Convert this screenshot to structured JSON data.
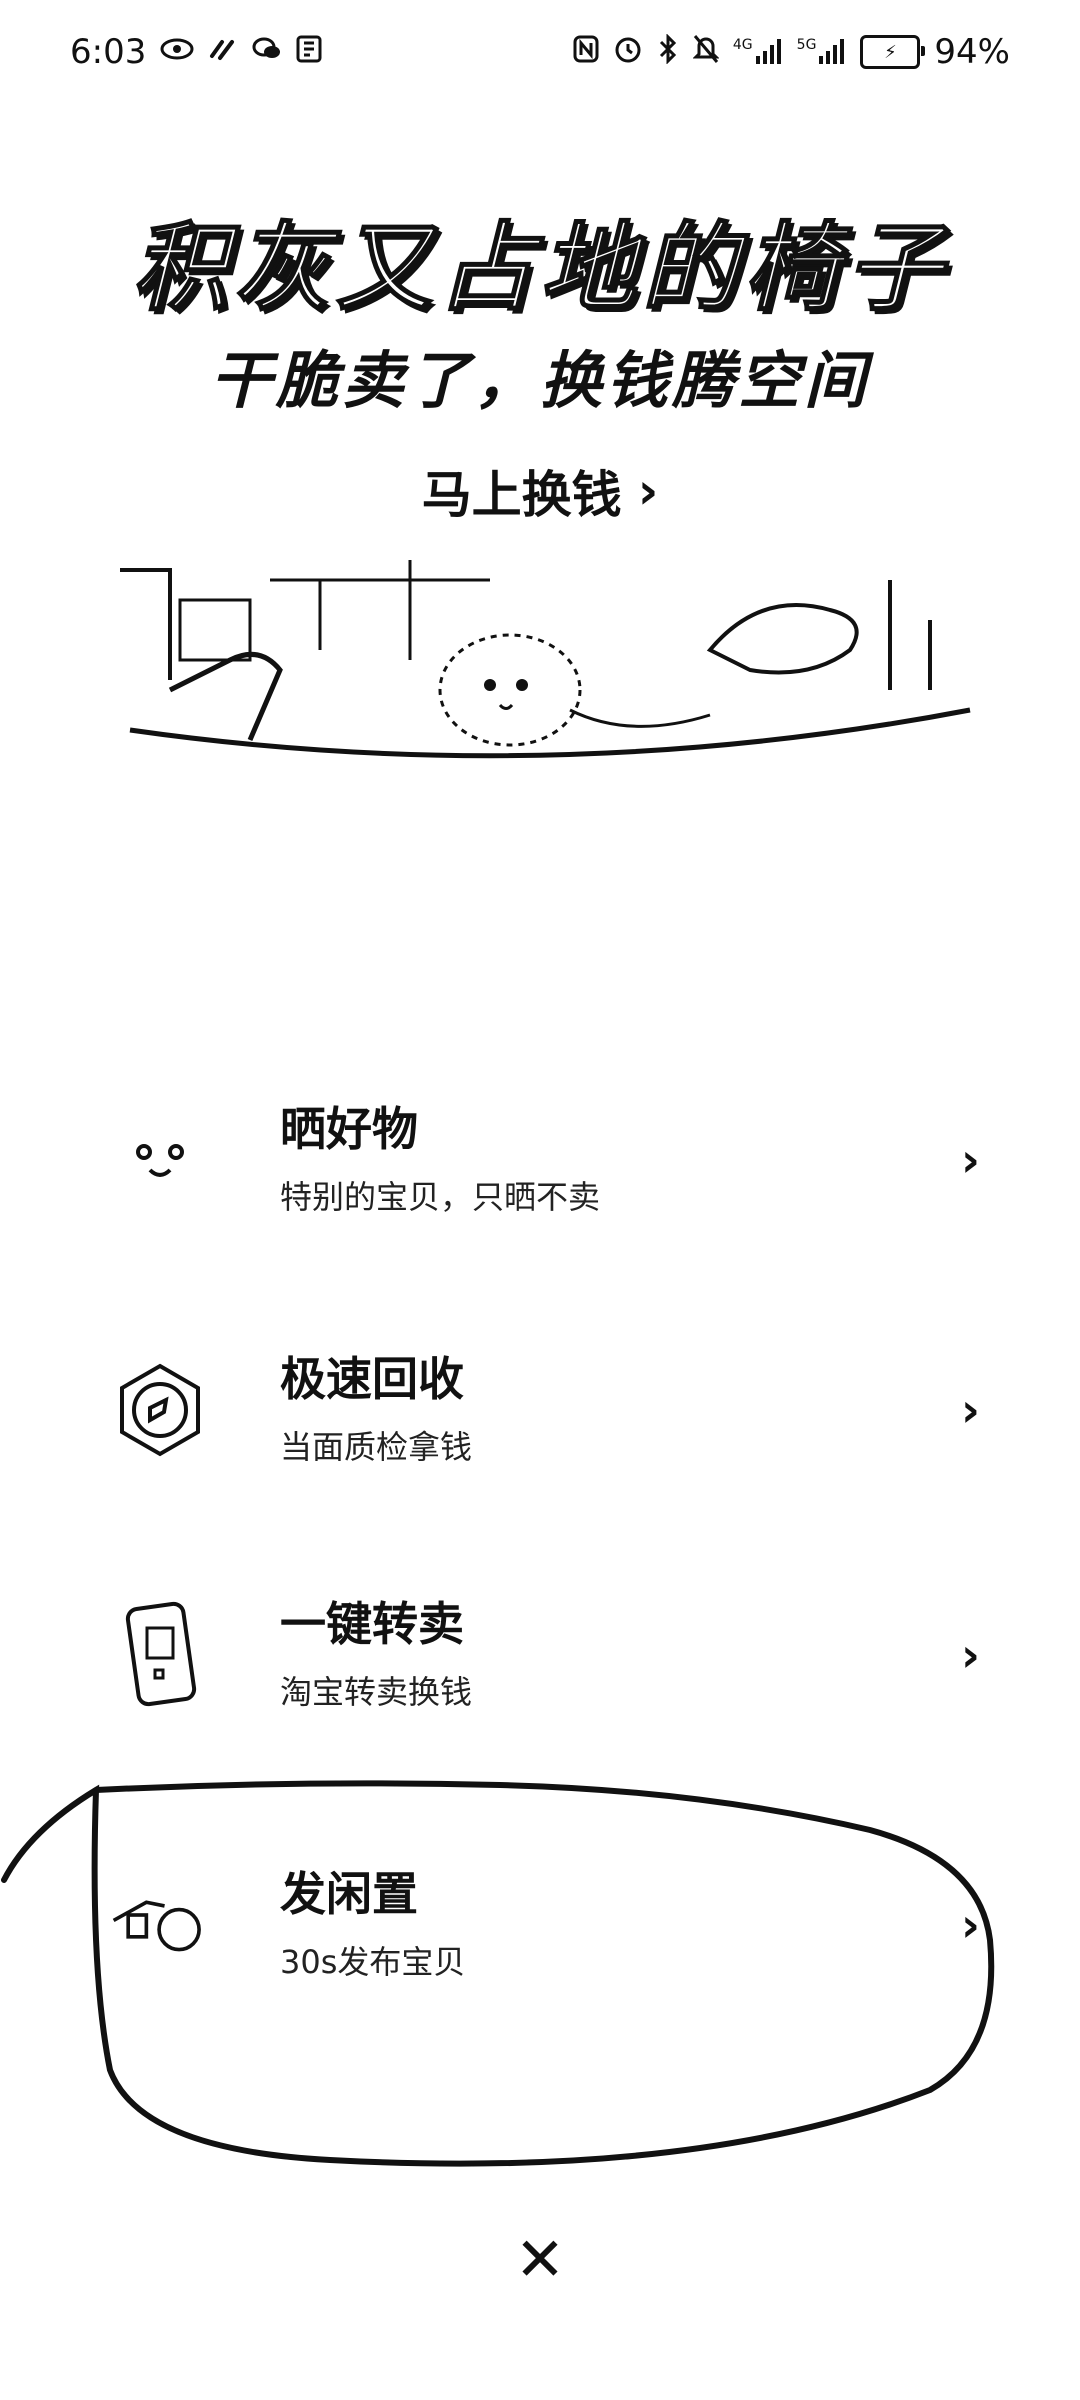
{
  "status_bar": {
    "time": "6:03",
    "battery_percent": "94%",
    "network_1": "4G",
    "network_2": "5G",
    "icons_left": [
      "eye-icon",
      "vpn-icon",
      "wechat-icon",
      "app-icon"
    ],
    "icons_right": [
      "nfc-icon",
      "alarm-icon",
      "bluetooth-icon",
      "mute-icon",
      "signal-icon",
      "signal-icon",
      "battery-icon"
    ]
  },
  "hero": {
    "title": "积灰又占地的椅子",
    "subtitle": "干脆卖了，换钱腾空间",
    "cta_label": "马上换钱",
    "cta_chevron": "›"
  },
  "menu": {
    "items": [
      {
        "title": "晒好物",
        "subtitle": "特别的宝贝，只晒不卖",
        "icon": "smile-icon",
        "chevron": "›"
      },
      {
        "title": "极速回收",
        "subtitle": "当面质检拿钱",
        "icon": "recycle-icon",
        "chevron": "›"
      },
      {
        "title": "一键转卖",
        "subtitle": "淘宝转卖换钱",
        "icon": "phone-icon",
        "chevron": "›"
      },
      {
        "title": "发闲置",
        "subtitle": "30s发布宝贝",
        "icon": "camera-icon",
        "chevron": "›"
      }
    ]
  },
  "close_symbol": "✕"
}
